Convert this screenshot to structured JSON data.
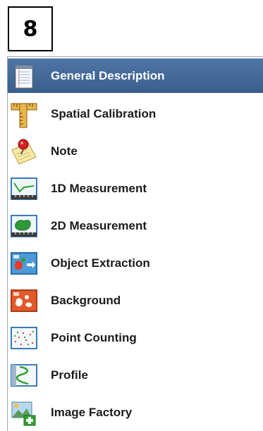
{
  "step_number": "8",
  "menu": {
    "selected_color": "#446a98",
    "items": [
      {
        "label": "General Description",
        "icon": "notepad-icon",
        "selected": true
      },
      {
        "label": "Spatial Calibration",
        "icon": "ruler-icon",
        "selected": false
      },
      {
        "label": "Note",
        "icon": "pushpin-note-icon",
        "selected": false
      },
      {
        "label": "1D Measurement",
        "icon": "line-measurement-icon",
        "selected": false
      },
      {
        "label": "2D Measurement",
        "icon": "area-measurement-icon",
        "selected": false
      },
      {
        "label": "Object Extraction",
        "icon": "object-extraction-icon",
        "selected": false
      },
      {
        "label": "Background",
        "icon": "background-icon",
        "selected": false
      },
      {
        "label": "Point Counting",
        "icon": "point-counting-icon",
        "selected": false
      },
      {
        "label": "Profile",
        "icon": "profile-icon",
        "selected": false
      },
      {
        "label": "Image Factory",
        "icon": "image-factory-icon",
        "selected": false
      }
    ]
  }
}
